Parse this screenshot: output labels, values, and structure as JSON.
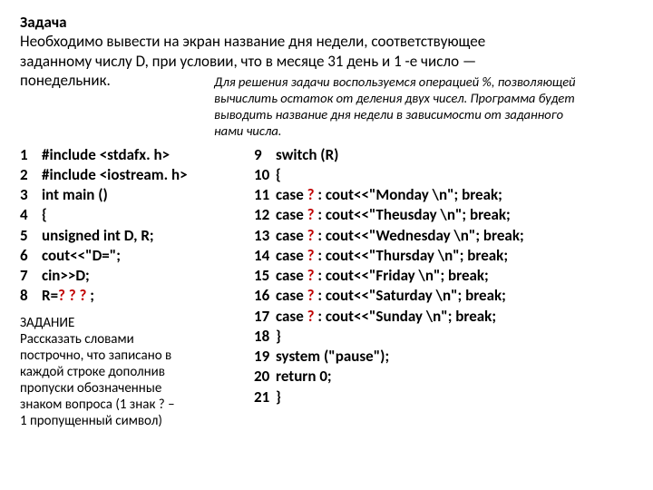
{
  "task": {
    "heading": "Задача",
    "text_line1": "Необходимо вывести на экран название дня недели, соответствующее",
    "text_line2": "заданному числу D, при условии, что в месяце 31 день и 1 -е число —",
    "text_line3": "понедельник."
  },
  "hint": {
    "line1": "Для решения задачи воспользуемся операцией %, позволяющей",
    "line2": "вычислить остаток от деления двух чисел. Программа будет",
    "line3": "выводить название дня недели в зависимости от заданного",
    "line4": "нами числа."
  },
  "left_code": [
    {
      "n": "1",
      "t": "#include <stdafx. h>"
    },
    {
      "n": "2",
      "t": "#include <iostream. h>"
    },
    {
      "n": "3",
      "t": "int main ()"
    },
    {
      "n": "4",
      "t": "{"
    },
    {
      "n": "5",
      "t": "unsigned int D, R;"
    },
    {
      "n": "6",
      "t": "cout<<\"D=\";"
    },
    {
      "n": "7",
      "t": "cin>>D;"
    }
  ],
  "left_line8": {
    "n": "8",
    "pre": "R=",
    "blank": "? ? ?",
    "post": " ;"
  },
  "right_code_first": {
    "n": "9",
    "t": "switch (R)"
  },
  "right_code_open": {
    "n": "10",
    "t": "{"
  },
  "cases": [
    {
      "n": "11",
      "day": "Monday"
    },
    {
      "n": "12",
      "day": "Theusday"
    },
    {
      "n": "13",
      "day": "Wednesday"
    },
    {
      "n": "14",
      "day": "Thursday"
    },
    {
      "n": "15",
      "day": "Friday"
    },
    {
      "n": "16",
      "day": "Saturday"
    },
    {
      "n": "17",
      "day": "Sunday"
    }
  ],
  "case_prefix": "case ",
  "case_blank": "?",
  "case_mid": " : cout<<\"",
  "case_suffix": " \\n\"; break;",
  "right_tail": [
    {
      "n": "18",
      "t": "}"
    },
    {
      "n": "19",
      "t": "system (\"pause\");"
    },
    {
      "n": "20",
      "t": "return 0;"
    },
    {
      "n": "21",
      "t": "}"
    }
  ],
  "assignment": {
    "heading": "ЗАДАНИЕ",
    "l1": "Рассказать словами",
    "l2": "построчно, что записано в",
    "l3": "каждой строке дополнив",
    "l4": "пропуски обозначенные",
    "l5": "знаком вопроса (1 знак ? –",
    "l6": "1 пропущенный символ)"
  }
}
